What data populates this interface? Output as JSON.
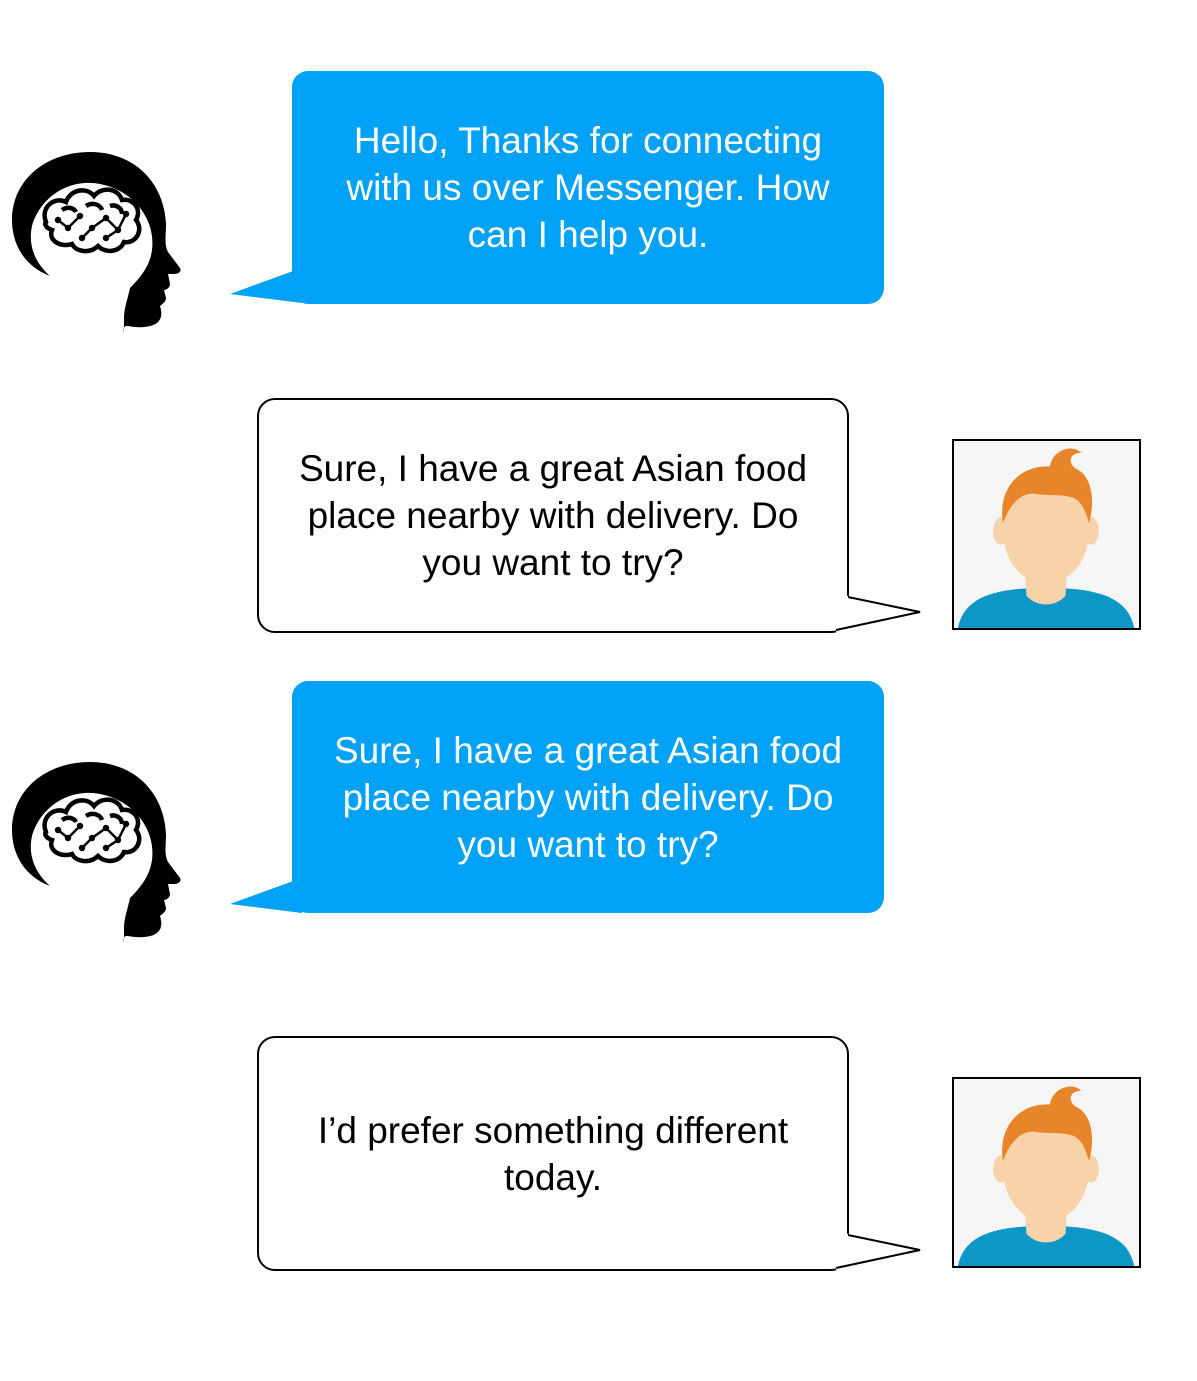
{
  "conversation": {
    "messages": [
      {
        "speaker": "bot",
        "text": "Hello, Thanks for connecting with us over Messenger. How can I help you.",
        "avatar_icon": "robot-brain-head-icon"
      },
      {
        "speaker": "user",
        "text": "Sure, I have a great Asian food place nearby with delivery. Do you want to try?",
        "avatar_icon": "user-avatar-icon"
      },
      {
        "speaker": "bot",
        "text": "Sure, I have a great Asian food place nearby with delivery. Do you want to try?",
        "avatar_icon": "robot-brain-head-icon"
      },
      {
        "speaker": "user",
        "text": "I’d prefer something different today.",
        "avatar_icon": "user-avatar-icon"
      }
    ]
  },
  "colors": {
    "bot_bubble": "#00a2f7",
    "bot_text": "#ffffff",
    "user_bubble": "#ffffff",
    "user_text": "#000000",
    "user_hair": "#e8842a",
    "user_skin": "#f8d2a9",
    "user_shirt": "#0d97c6"
  }
}
